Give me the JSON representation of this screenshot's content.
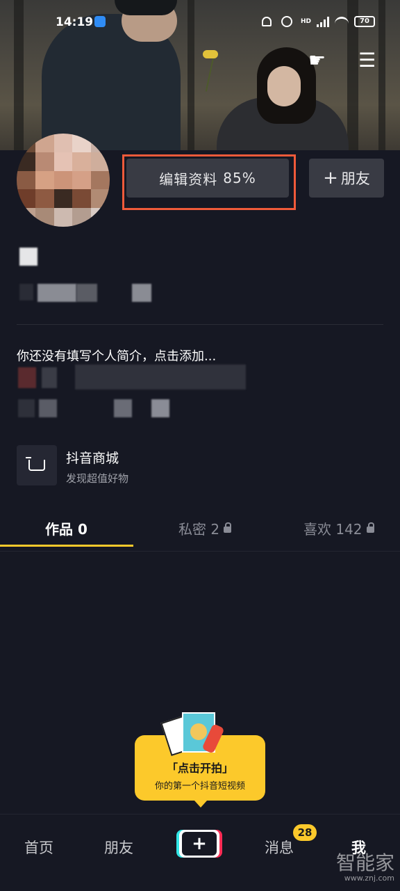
{
  "status_bar": {
    "time": "14:19",
    "battery": "70",
    "network": "HD"
  },
  "header": {
    "hand_icon": "hand-point-icon",
    "menu_icon": "menu-icon"
  },
  "profile": {
    "edit_label": "编辑资料",
    "edit_percent": "85%",
    "add_friend_label": "朋友",
    "bio": "你还没有填写个人简介，点击添加..."
  },
  "mall": {
    "title": "抖音商城",
    "subtitle": "发现超值好物"
  },
  "tabs": [
    {
      "label": "作品 0",
      "active": true,
      "locked": false
    },
    {
      "label": "私密 2",
      "active": false,
      "locked": true
    },
    {
      "label": "喜欢 142",
      "active": false,
      "locked": true
    }
  ],
  "bubble": {
    "title": "「点击开拍」",
    "subtitle": "你的第一个抖音短视频"
  },
  "nav": {
    "home": "首页",
    "friends": "朋友",
    "messages": "消息",
    "messages_badge": "28",
    "me": "我"
  },
  "watermark": {
    "text": "智能家",
    "url": "www.znj.com"
  },
  "colors": {
    "background": "#161823",
    "accent": "#fcc92b",
    "highlight_border": "#f05a3a"
  }
}
